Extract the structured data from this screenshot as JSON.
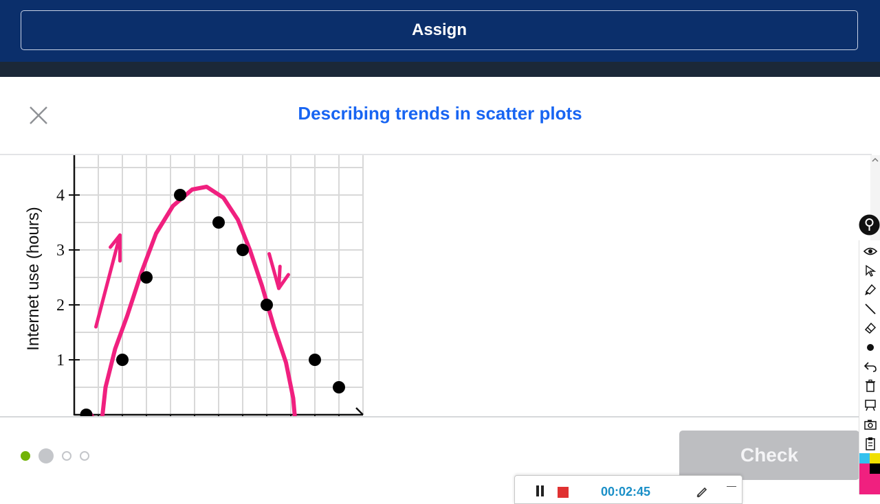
{
  "top_bar": {
    "assign_label": "Assign"
  },
  "exercise": {
    "title": "Describing trends in scatter plots"
  },
  "chart_data": {
    "type": "scatter",
    "ylabel": "Internet use (hours)",
    "xlabel": "",
    "y_ticks": [
      "1",
      "2",
      "3",
      "4"
    ],
    "x_range": [
      0,
      12
    ],
    "ylim": [
      0,
      4.5
    ],
    "grid": true,
    "points": [
      {
        "x": 0.5,
        "y": 0
      },
      {
        "x": 2,
        "y": 1
      },
      {
        "x": 3,
        "y": 2.5
      },
      {
        "x": 4.4,
        "y": 4
      },
      {
        "x": 6,
        "y": 3.5
      },
      {
        "x": 7,
        "y": 3
      },
      {
        "x": 8,
        "y": 2
      },
      {
        "x": 10,
        "y": 1
      },
      {
        "x": 11,
        "y": 0.5
      }
    ],
    "annotation_color": "#f0207f",
    "marker_color": "#000000"
  },
  "footer": {
    "progress": [
      "done",
      "current",
      "todo",
      "todo"
    ],
    "check_label": "Check"
  },
  "recorder": {
    "timer": "00:02:45"
  },
  "drawing_tools": [
    {
      "icon": "eye-icon",
      "active": true
    },
    {
      "icon": "cursor-arrow-icon",
      "active": false
    },
    {
      "icon": "highlighter-icon",
      "active": true
    },
    {
      "icon": "line-icon",
      "active": false
    },
    {
      "icon": "eraser-icon",
      "active": false
    },
    {
      "icon": "dot-size-icon",
      "active": false
    },
    {
      "icon": "undo-icon",
      "active": false
    },
    {
      "icon": "trash-icon",
      "active": false
    },
    {
      "icon": "board-icon",
      "active": false
    },
    {
      "icon": "camera-icon",
      "active": false
    },
    {
      "icon": "clipboard-icon",
      "active": false
    }
  ],
  "swatch_colors": [
    "#33c1ee",
    "#f0e000",
    "#f0207f",
    "#000000"
  ],
  "colors": {
    "top_bar": "#0b2f6b",
    "title": "#1865f2",
    "progress_done": "#71b307",
    "check_disabled": "#bdbec1"
  }
}
